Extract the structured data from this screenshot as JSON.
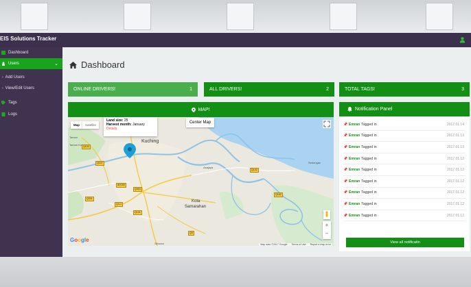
{
  "app": {
    "brand": "EIS Solutions Tracker"
  },
  "sidebar": {
    "items": [
      {
        "label": "Dashboard",
        "icon": "dashboard-icon"
      },
      {
        "label": "Users",
        "icon": "users-icon",
        "active": true
      },
      {
        "label": "Tags",
        "icon": "tag-icon"
      },
      {
        "label": "Logs",
        "icon": "logs-icon"
      }
    ],
    "sub_items": [
      {
        "label": "Add Users"
      },
      {
        "label": "View/Edit Users"
      }
    ]
  },
  "page": {
    "title": "Dashboard"
  },
  "stats": [
    {
      "label": "ONLINE DRIVERS!",
      "value": "1"
    },
    {
      "label": "ALL DRIVERS!",
      "value": "2"
    },
    {
      "label": "TOTAL TAGS!",
      "value": "3"
    }
  ],
  "map_panel": {
    "header": "MAP!",
    "type_map": "Map",
    "type_satellite": "Satellite",
    "center_button": "Center Map",
    "info": {
      "land_label": "Land size:",
      "land_value": "25",
      "harvest_label": "Harvest month:",
      "harvest_value": "January",
      "details": "Details"
    },
    "places": {
      "kuching": "Kuching",
      "kota": "Kota",
      "samarahan": "Samarahan",
      "asajaya": "Asajaya",
      "sebangan": "Sebangan",
      "tanah": "Taman",
      "kubah": "Taman Kubah",
      "siburan": "Siburan"
    },
    "google": "Google",
    "footer_data": "Map data ©2017 Google",
    "footer_terms": "Terms of Use",
    "footer_report": "Report a map error"
  },
  "notifications": {
    "header": "Notification Panel",
    "items": [
      {
        "who": "Emran",
        "text": "Tagged in",
        "date": "2017.01.14"
      },
      {
        "who": "Emran",
        "text": "Tagged in",
        "date": "2017.01.13"
      },
      {
        "who": "Emran",
        "text": "Tagged in",
        "date": "2017.01.13"
      },
      {
        "who": "Emran",
        "text": "Tagged in",
        "date": "2017.01.12"
      },
      {
        "who": "Emran",
        "text": "Tagged in",
        "date": "2017.01.12"
      },
      {
        "who": "Emran",
        "text": "Tagged in",
        "date": "2017.01.12"
      },
      {
        "who": "Emran",
        "text": "Tagged in",
        "date": "2017.01.12"
      },
      {
        "who": "Emran",
        "text": "Tagged in",
        "date": "2017.01.12"
      },
      {
        "who": "Emran",
        "text": "Tagged in",
        "date": "2017.01.12"
      }
    ],
    "view_all": "View all notificatin"
  },
  "colors": {
    "brand_green": "#138f16",
    "light_green": "#4aae4c",
    "sidebar_purple": "#3f3350",
    "topbar_purple": "#3d304f"
  }
}
